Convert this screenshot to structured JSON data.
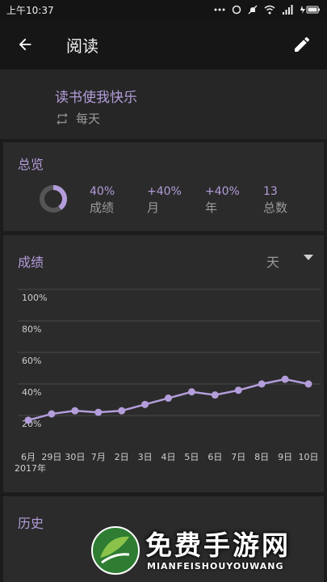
{
  "status_bar": {
    "time": "上午10:37"
  },
  "app_bar": {
    "title": "阅读"
  },
  "habit": {
    "name": "读书使我快乐",
    "frequency": "每天"
  },
  "overview": {
    "title": "总览",
    "ring_fraction": 0.4,
    "stats": [
      {
        "value": "40%",
        "label": "成绩"
      },
      {
        "value": "+40%",
        "label": "月"
      },
      {
        "value": "+40%",
        "label": "年"
      },
      {
        "value": "13",
        "label": "总数"
      }
    ]
  },
  "score": {
    "title": "成绩",
    "range": "天"
  },
  "chart_data": {
    "type": "line",
    "y_ticks": [
      "100%",
      "80%",
      "60%",
      "40%",
      "20%"
    ],
    "ylim": [
      0,
      100
    ],
    "x_labels": [
      "6月",
      "29日",
      "30日",
      "7月",
      "2日",
      "3日",
      "4日",
      "5日",
      "6日",
      "7日",
      "8日",
      "9日",
      "10日"
    ],
    "x_sublabel": "2017年",
    "values": [
      17,
      21,
      23,
      22,
      23,
      27,
      31,
      35,
      33,
      36,
      40,
      43,
      40
    ],
    "colors": {
      "line": "#b39ddb",
      "grid": "#4a4a4a",
      "axis_text": "#cfcfcf"
    }
  },
  "history": {
    "title": "历史"
  },
  "watermark": {
    "title": "免费手游网",
    "subtitle": "MIANFEISHOUYOUWANG"
  }
}
